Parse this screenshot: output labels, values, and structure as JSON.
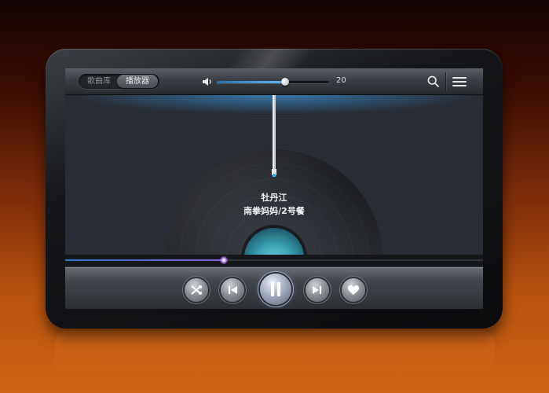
{
  "header": {
    "tabs": [
      {
        "label": "歌曲库",
        "active": false
      },
      {
        "label": "播放器",
        "active": true
      }
    ],
    "volume": {
      "value": 20,
      "level": 0.61
    }
  },
  "now_playing": {
    "title": "牡丹江",
    "artist": "南拳妈妈/2号餐",
    "progress": 0.38
  },
  "controls": [
    "shuffle-icon",
    "previous-icon",
    "pause-icon",
    "next-icon",
    "heart-icon"
  ],
  "colors": {
    "accent_blue": "#4fa3e0",
    "progress_purple": "#b46eff",
    "disc_center": "#3aa0b4",
    "background_orange": "#cf6415"
  }
}
